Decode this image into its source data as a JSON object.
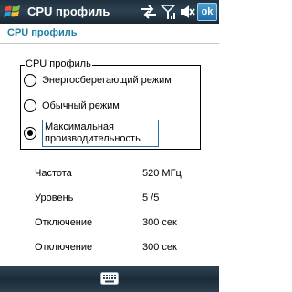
{
  "titlebar": {
    "app_title": "CPU профиль",
    "ok_label": "ok"
  },
  "header": {
    "title": "CPU профиль"
  },
  "profile_group": {
    "legend": "CPU профиль",
    "options": [
      {
        "label": "Энергосберегающий режим",
        "checked": false
      },
      {
        "label": "Обычный режим",
        "checked": false
      },
      {
        "label": "Максимальная производительность",
        "checked": true
      }
    ]
  },
  "info": [
    {
      "label": "Частота",
      "value": "520 МГц"
    },
    {
      "label": "Уровень",
      "value": "5 /5"
    },
    {
      "label": "Отключение",
      "value": "300 сек"
    },
    {
      "label": "Отключение",
      "value": "300 сек"
    }
  ],
  "colors": {
    "title_bar": "#2b4152",
    "header_text": "#1f7fa3",
    "ok_button": "#1f6ea8"
  },
  "icons": {
    "start": "windows-flag-icon",
    "connectivity": "sync-arrows-icon",
    "signal": "signal-strength-icon",
    "volume": "speaker-muted-icon",
    "keyboard": "keyboard-icon"
  }
}
